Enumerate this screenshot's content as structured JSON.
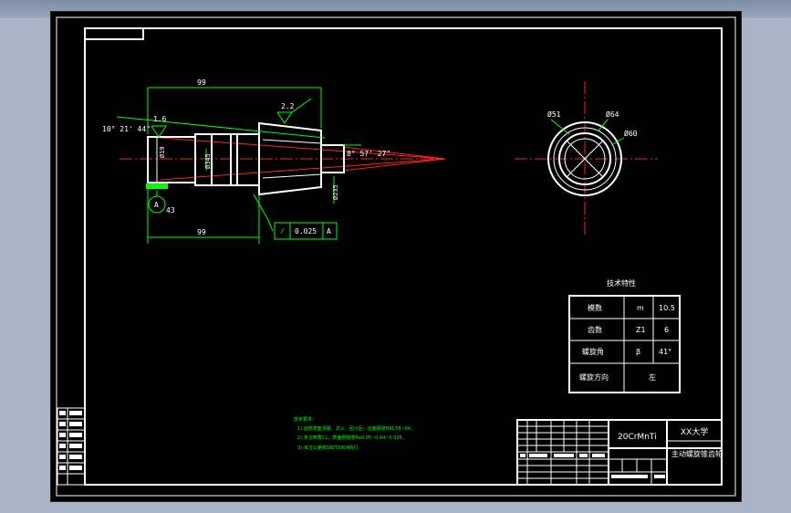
{
  "dimensions": {
    "length_top": "99",
    "length_bottom": "99",
    "cone_angle": "10° 21' 44\"",
    "root_angle": "8° 57' 27\"",
    "roughness_left": "1.6",
    "roughness_right": "2.2",
    "dia_front": "Ø19",
    "dia_journal": "Ø345",
    "dia_end": "Ø235",
    "datum_dim": "43",
    "datum_letter": "A",
    "tolerance_symbol": "/",
    "tolerance_value": "0.025",
    "tolerance_datum": "A",
    "front_dia_51": "Ø51",
    "front_dia_64": "Ø64",
    "front_dia_60": "Ø60"
  },
  "tech_table": {
    "title": "技术特性",
    "rows": [
      {
        "name": "模数",
        "symbol": "m",
        "value": "10.5"
      },
      {
        "name": "齿数",
        "symbol": "Z1",
        "value": "6"
      },
      {
        "name": "螺旋角",
        "symbol": "β",
        "value": "41°"
      },
      {
        "name": "螺旋方向",
        "symbol": "",
        "value": "左"
      }
    ]
  },
  "notes": {
    "title": "技术要求：",
    "lines": [
      "1) 齿部表面渗碳、淬火、回火后，齿面硬度HRC58~64。",
      "2) 未注倒角C1，表面粗糙度Ra0.05~0.04~0.025。",
      "3) 未注公差按GB/T1804执行。"
    ]
  },
  "title_block": {
    "material": "20CrMnTi",
    "school": "XX大学",
    "part_name": "主动螺旋锥齿轮"
  },
  "colors": {
    "line_white": "#ffffff",
    "dim_green": "#00ff00",
    "center_red": "#ff2020"
  }
}
